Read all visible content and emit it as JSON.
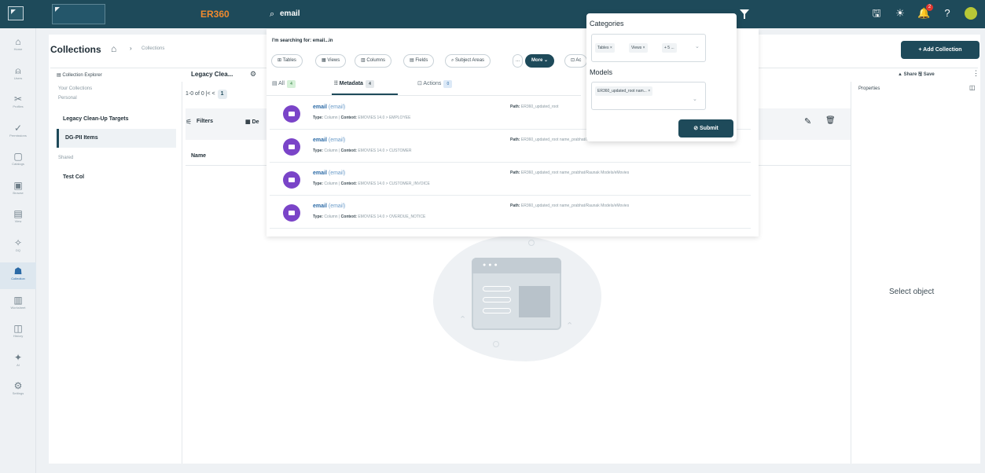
{
  "topbar": {
    "app_name": "ER360",
    "search_query": "email",
    "icons": [
      "database-icon",
      "sun-icon",
      "bell-icon",
      "help-icon",
      "avatar"
    ],
    "notification_count": "2"
  },
  "rail": [
    {
      "name": "home",
      "label": "Home",
      "icon": "⌂"
    },
    {
      "name": "users",
      "label": "Users",
      "icon": "⍝"
    },
    {
      "name": "profiles",
      "label": "Profiles",
      "icon": "✂"
    },
    {
      "name": "permissions",
      "label": "Permissions",
      "icon": "✓"
    },
    {
      "name": "catalogs",
      "label": "Catalogs",
      "icon": "▢"
    },
    {
      "name": "browse",
      "label": "Browse",
      "icon": "▣"
    },
    {
      "name": "view",
      "label": "View",
      "icon": "▤"
    },
    {
      "name": "dq",
      "label": "DQ",
      "icon": "✧"
    },
    {
      "name": "collection",
      "label": "Collection",
      "icon": "☗"
    },
    {
      "name": "worksheet",
      "label": "Worksheet",
      "icon": "▥"
    },
    {
      "name": "history",
      "label": "History",
      "icon": "◫"
    },
    {
      "name": "ai",
      "label": "AI",
      "icon": "✦"
    },
    {
      "name": "settings",
      "label": "Settings",
      "icon": "⚙"
    }
  ],
  "page": {
    "title": "Collections",
    "breadcrumb": "Collections",
    "add_button": "+ Add Collection",
    "explorer_title": "Collection Explorer",
    "tab_label": "Legacy Clea...",
    "share_save": "▲ Share  🖫 Save",
    "properties": "Properties",
    "select_object": "Select object",
    "pager": "1-0 of 0  |<  <",
    "pager_page": "1",
    "filters": "Filters",
    "de": "De",
    "name_col": "Name"
  },
  "explorer": {
    "your_collections": "Your Collections",
    "personal": "Personal",
    "items_personal": [
      "Legacy Clean-Up Targets",
      "DG-PII Items"
    ],
    "shared": "Shared",
    "items_shared": [
      "Test Col"
    ]
  },
  "search": {
    "searching_for": "I'm searching for: email...in",
    "chips": [
      "⊞ Tables",
      "▦ Views",
      "▥ Columns",
      "▤ Fields",
      "⌕ Subject Areas",
      "..."
    ],
    "more": "More ⌄",
    "ac": "⊡ Ac",
    "tabs": [
      {
        "label": "▤ All",
        "count": "4"
      },
      {
        "label": "⁞⁞ Metadata",
        "count": "4"
      },
      {
        "label": "⊡ Actions",
        "count": "0"
      }
    ],
    "results": [
      {
        "name": "email",
        "sub": "(email)",
        "type": "Column",
        "context": "EMOVIES 14.0 > EMPLOYEE",
        "path": "ER360_updated_root"
      },
      {
        "name": "email",
        "sub": "(email)",
        "type": "Column",
        "context": "EMOVIES 14.0 > CUSTOMER",
        "path": "ER360_updated_root name_prabhat/Raunak Models/eMovies"
      },
      {
        "name": "email",
        "sub": "(email)",
        "type": "Column",
        "context": "EMOVIES 14.0 > CUSTOMER_INVOICE",
        "path": "ER360_updated_root name_prabhat/Raunak Models/eMovies"
      },
      {
        "name": "email",
        "sub": "(email)",
        "type": "Column",
        "context": "EMOVIES 14.0 > OVERDUE_NOTICE",
        "path": "ER360_updated_root name_prabhat/Raunak Models/eMovies"
      }
    ],
    "type_label": "Type:",
    "context_label": "Context:",
    "path_label": "Path:"
  },
  "categories_popup": {
    "title": "Categories",
    "chips": [
      "Tables ×",
      "Views ×",
      "+ 5 ..."
    ],
    "models_title": "Models",
    "model_chip": "ER360_updated_root nam... ×",
    "submit": "⊘ Submit"
  }
}
